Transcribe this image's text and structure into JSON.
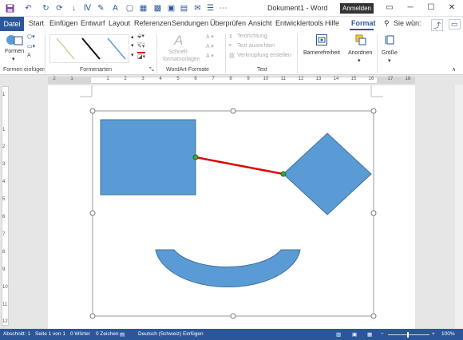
{
  "window": {
    "title": "Dokument1 - Word",
    "signin_label": "Anmelden"
  },
  "tabs": {
    "file": "Datei",
    "items": [
      "Start",
      "Einfügen",
      "Entwurf",
      "Layout",
      "Referenzen",
      "Sendungen",
      "Überprüfen",
      "Ansicht",
      "Entwicklertools",
      "Hilfe"
    ],
    "format": "Format",
    "search_placeholder": "Sie wün:"
  },
  "ribbon": {
    "insert_shapes": {
      "label": "Formen einfügen",
      "shapes_btn": "Formen"
    },
    "shape_styles": {
      "label": "Formenarten"
    },
    "wordart": {
      "label": "WordArt-Formate",
      "quick_styles_line1": "Schnell-",
      "quick_styles_line2": "formatvorlagen"
    },
    "text": {
      "label": "Text",
      "direction": "Textrichtung",
      "align": "Text ausrichten",
      "link": "Verknüpfung erstellen"
    },
    "accessibility": {
      "label": "Barrierefreiheit"
    },
    "arrange": {
      "label": "Anordnen"
    },
    "size": {
      "label": "Größe"
    },
    "colors": {
      "accent": "#2b579a",
      "shape_fill": "#5b9bd5",
      "connector": "#e00000"
    }
  },
  "ruler": {
    "h": [
      "2",
      "1",
      "1",
      "2",
      "3",
      "4",
      "5",
      "6",
      "7",
      "8",
      "9",
      "10",
      "11",
      "12",
      "13",
      "14",
      "15",
      "16",
      "17",
      "18"
    ],
    "v": [
      "1",
      "1",
      "2",
      "3",
      "4",
      "5",
      "6",
      "7",
      "8",
      "9",
      "10",
      "11",
      "12"
    ]
  },
  "canvas": {
    "shapes": [
      "rectangle",
      "diamond",
      "block-arc",
      "connector-line"
    ]
  },
  "status": {
    "section": "Abschnitt: 1",
    "page": "Seite 1 von 1",
    "words": "0 Wörter",
    "chars": "0 Zeichen",
    "language": "Deutsch (Schweiz)",
    "mode": "Einfügen",
    "zoom": "100%"
  }
}
